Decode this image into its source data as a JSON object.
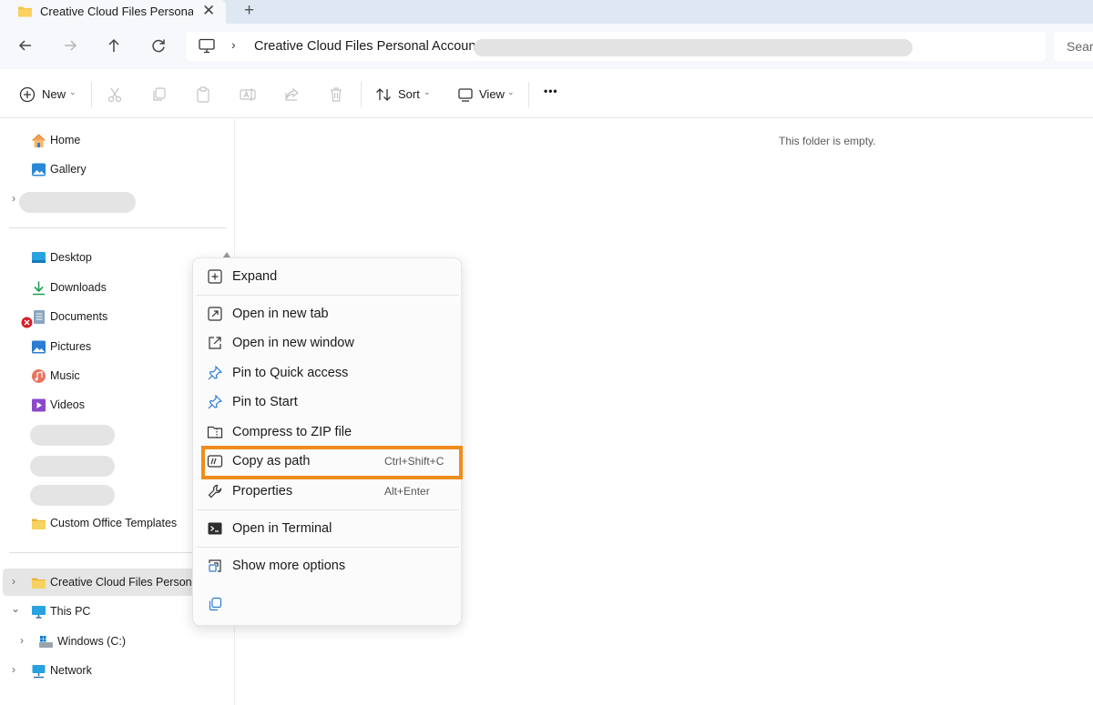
{
  "tab": {
    "title": "Creative Cloud Files Personal Account",
    "close_glyph": "✕",
    "new_tab_glyph": "+"
  },
  "address": {
    "chevron": "›",
    "path": "Creative Cloud Files Personal Account"
  },
  "search": {
    "placeholder": "Search"
  },
  "toolbar": {
    "new_label": "New",
    "sort_label": "Sort",
    "view_label": "View",
    "more_glyph": "•••",
    "caret": "⌄"
  },
  "sidebar": {
    "home": "Home",
    "gallery": "Gallery",
    "desktop": "Desktop",
    "downloads": "Downloads",
    "documents": "Documents",
    "pictures": "Pictures",
    "music": "Music",
    "videos": "Videos",
    "custom_templates": "Custom Office Templates",
    "cc_files": "Creative Cloud Files Personal Account",
    "this_pc": "This PC",
    "windows_c": "Windows (C:)",
    "network": "Network",
    "chevron_right": "›",
    "chevron_down": "⌄"
  },
  "main": {
    "empty_message": "This folder is empty."
  },
  "context_menu": {
    "expand": "Expand",
    "open_new_tab": "Open in new tab",
    "open_new_window": "Open in new window",
    "pin_quick_access": "Pin to Quick access",
    "pin_start": "Pin to Start",
    "compress_zip": "Compress to ZIP file",
    "copy_as_path": "Copy as path",
    "copy_as_path_shortcut": "Ctrl+Shift+C",
    "properties": "Properties",
    "properties_shortcut": "Alt+Enter",
    "open_terminal": "Open in Terminal",
    "show_more": "Show more options"
  },
  "colors": {
    "highlight": "#ef8d1c",
    "accent": "#0067c0",
    "folder": "#f5c542"
  }
}
